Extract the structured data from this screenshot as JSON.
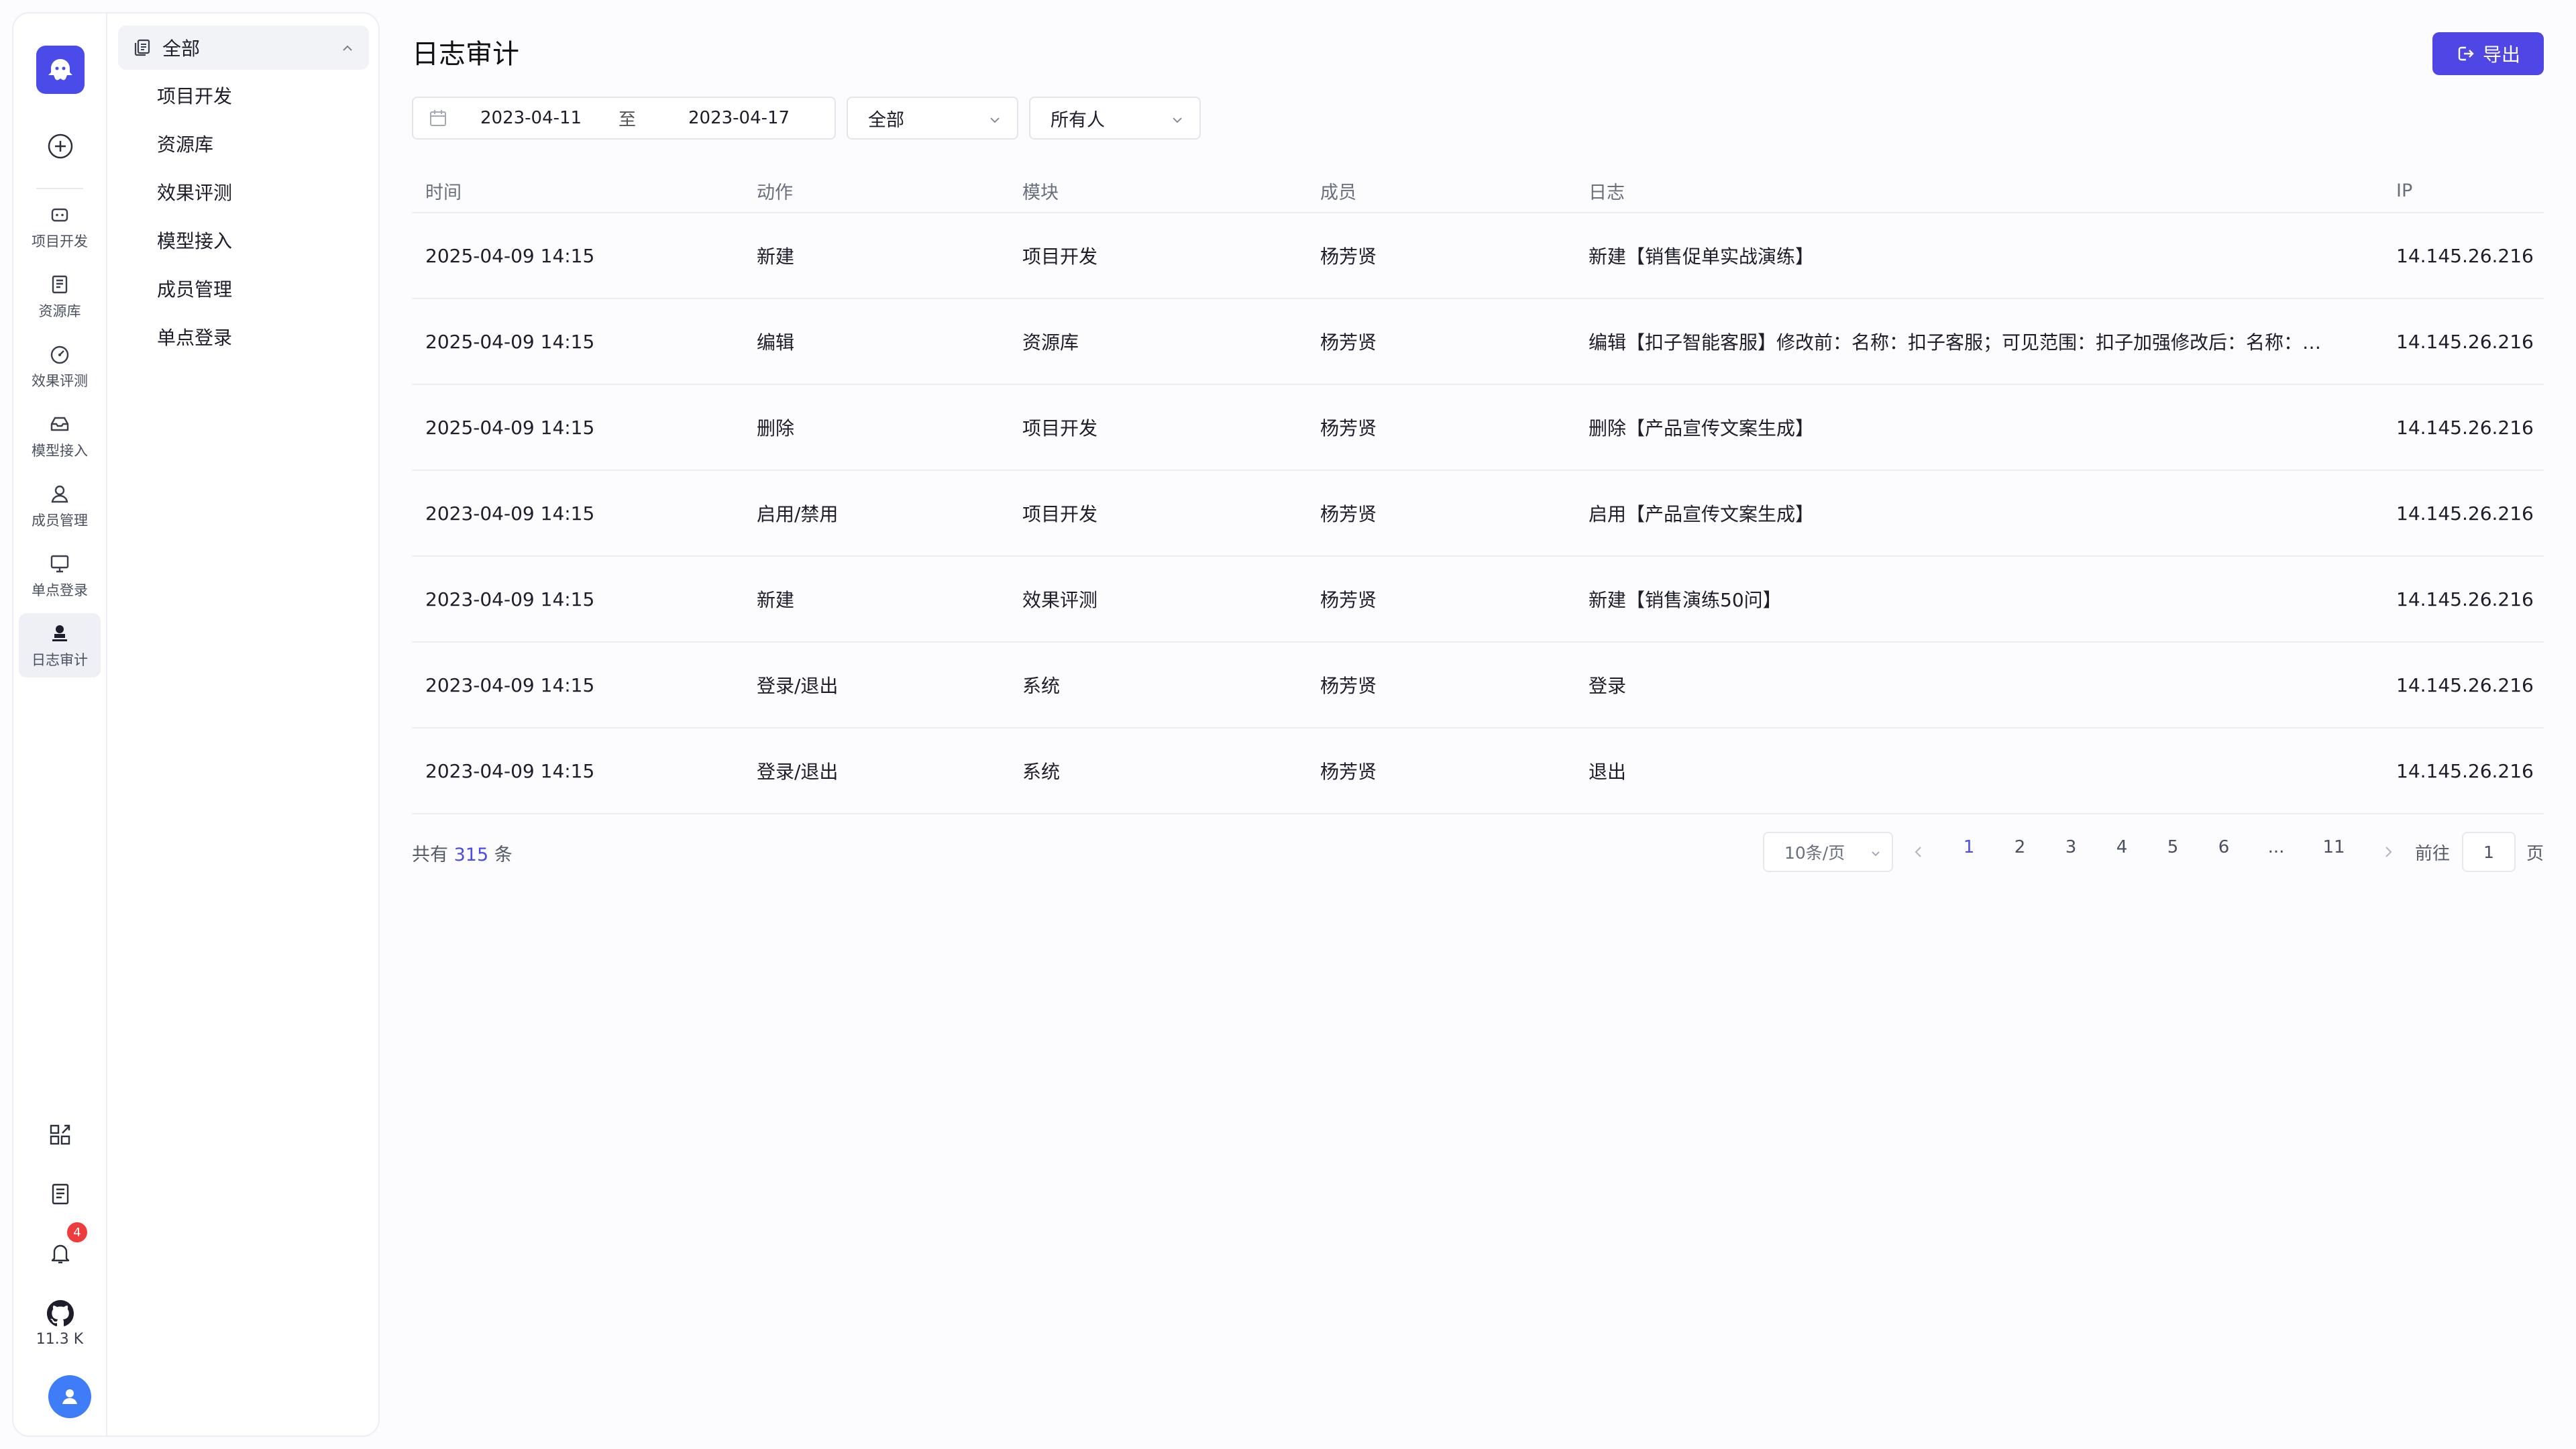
{
  "rail": {
    "items": [
      {
        "label": "项目开发",
        "icon": "project-dev-icon"
      },
      {
        "label": "资源库",
        "icon": "resource-library-icon"
      },
      {
        "label": "效果评测",
        "icon": "evaluation-gauge-icon"
      },
      {
        "label": "模型接入",
        "icon": "model-access-icon"
      },
      {
        "label": "成员管理",
        "icon": "member-icon"
      },
      {
        "label": "单点登录",
        "icon": "sso-monitor-icon"
      },
      {
        "label": "日志审计",
        "icon": "audit-log-icon",
        "active": true
      }
    ],
    "notification_count": "4",
    "github_stars": "11.3 K"
  },
  "subnav": {
    "header": "全部",
    "items": [
      "项目开发",
      "资源库",
      "效果评测",
      "模型接入",
      "成员管理",
      "单点登录"
    ]
  },
  "page": {
    "title": "日志审计",
    "export_label": "导出"
  },
  "filters": {
    "date_start": "2023-04-11",
    "date_sep": "至",
    "date_end": "2023-04-17",
    "module_select": "全部",
    "member_select": "所有人"
  },
  "table": {
    "headers": {
      "time": "时间",
      "action": "动作",
      "module": "模块",
      "member": "成员",
      "log": "日志",
      "ip": "IP"
    },
    "rows": [
      {
        "time": "2025-04-09 14:15",
        "action": "新建",
        "module": "项目开发",
        "member": "杨芳贤",
        "log": "新建【销售促单实战演练】",
        "ip": "14.145.26.216"
      },
      {
        "time": "2025-04-09 14:15",
        "action": "编辑",
        "module": "资源库",
        "member": "杨芳贤",
        "log": "编辑【扣子智能客服】修改前：名称：扣子客服；可见范围：扣子加强修改后：名称：…",
        "ip": "14.145.26.216"
      },
      {
        "time": "2025-04-09 14:15",
        "action": "删除",
        "module": "项目开发",
        "member": "杨芳贤",
        "log": "删除【产品宣传文案生成】",
        "ip": "14.145.26.216"
      },
      {
        "time": "2023-04-09 14:15",
        "action": "启用/禁用",
        "module": "项目开发",
        "member": "杨芳贤",
        "log": "启用【产品宣传文案生成】",
        "ip": "14.145.26.216"
      },
      {
        "time": "2023-04-09 14:15",
        "action": "新建",
        "module": "效果评测",
        "member": "杨芳贤",
        "log": "新建【销售演练50问】",
        "ip": "14.145.26.216"
      },
      {
        "time": "2023-04-09 14:15",
        "action": "登录/退出",
        "module": "系统",
        "member": "杨芳贤",
        "log": "登录",
        "ip": "14.145.26.216"
      },
      {
        "time": "2023-04-09 14:15",
        "action": "登录/退出",
        "module": "系统",
        "member": "杨芳贤",
        "log": "退出",
        "ip": "14.145.26.216"
      }
    ]
  },
  "pagination": {
    "total_prefix": "共有",
    "total": "315",
    "total_suffix": "条",
    "page_size": "10条/页",
    "pages": [
      "1",
      "2",
      "3",
      "4",
      "5",
      "6",
      "...",
      "11"
    ],
    "current": "1",
    "goto_label": "前往",
    "goto_value": "1",
    "goto_suffix": "页"
  },
  "colors": {
    "accent": "#4a4be8",
    "export_button": "#5046e5",
    "badge": "#ee3b3b",
    "avatar": "#3f7cf7"
  }
}
